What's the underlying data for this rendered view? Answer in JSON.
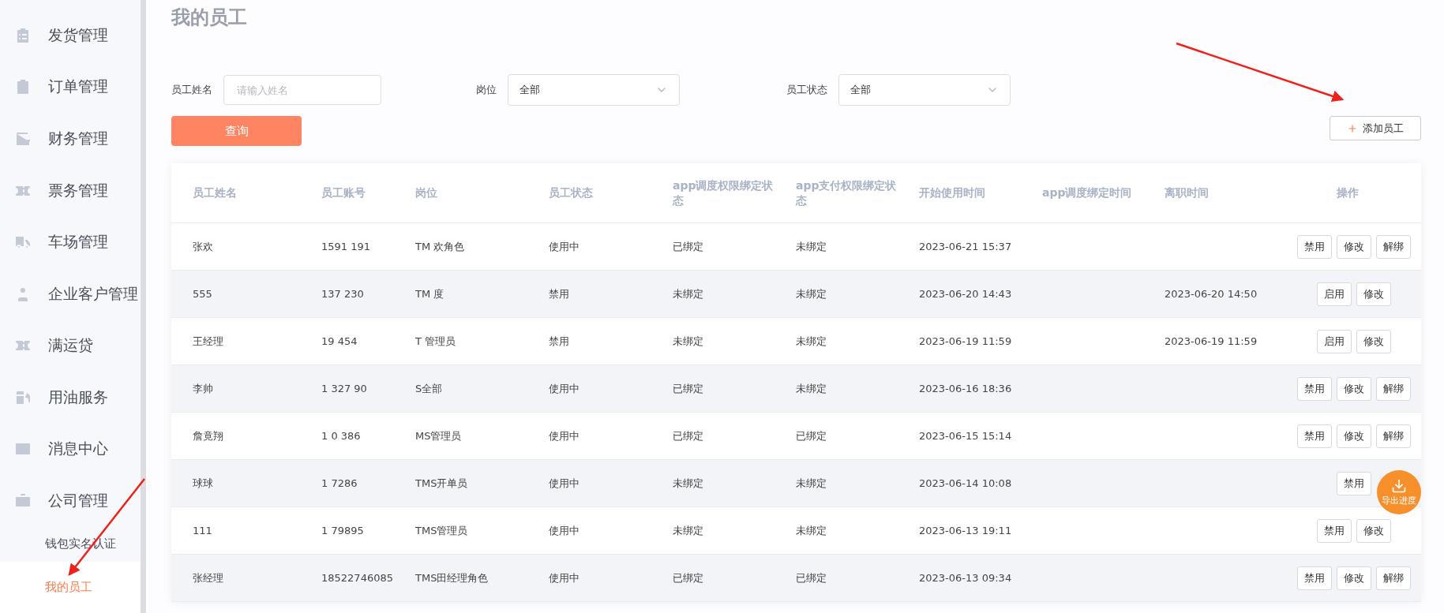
{
  "sidebar": {
    "items": [
      {
        "label": "发货管理",
        "selected": false
      },
      {
        "label": "订单管理",
        "selected": false
      },
      {
        "label": "财务管理",
        "selected": false
      },
      {
        "label": "票务管理",
        "selected": false
      },
      {
        "label": "车场管理",
        "selected": false
      },
      {
        "label": "企业客户管理",
        "selected": false
      },
      {
        "label": "满运贷",
        "selected": false
      },
      {
        "label": "用油服务",
        "selected": false
      },
      {
        "label": "消息中心",
        "selected": false
      },
      {
        "label": "公司管理",
        "selected": false,
        "expanded": true,
        "children": [
          {
            "label": "钱包实名认证",
            "selected": false
          },
          {
            "label": "我的员工",
            "selected": true
          }
        ]
      }
    ]
  },
  "page_title": "我的员工",
  "filters": [
    {
      "kind": "text",
      "label": "员工姓名",
      "placeholder": "请输入姓名"
    },
    {
      "kind": "select",
      "label": "岗位",
      "value": "全部"
    },
    {
      "kind": "select",
      "label": "员工状态",
      "value": "全部"
    }
  ],
  "query_button": "查询",
  "add_button": "添加员工",
  "table": {
    "columns": [
      "员工姓名",
      "员工账号",
      "岗位",
      "员工状态",
      "app调度权限绑定状态",
      "app支付权限绑定状态",
      "开始使用时间",
      "app调度绑定时间",
      "离职时间",
      "操作"
    ],
    "rows": [
      {
        "cells": [
          "张欢",
          "1591 191",
          "TM 欢角色",
          "使用中",
          "已绑定",
          "未绑定",
          "2023-06-21 15:37",
          "",
          ""
        ],
        "actions": [
          "禁用",
          "修改",
          "解绑"
        ]
      },
      {
        "cells": [
          "555",
          "137 230",
          "TM 度",
          "禁用",
          "未绑定",
          "未绑定",
          "2023-06-20 14:43",
          "",
          "2023-06-20 14:50"
        ],
        "actions": [
          "启用",
          "修改"
        ]
      },
      {
        "cells": [
          "王经理",
          "19 454",
          "T 管理员",
          "禁用",
          "未绑定",
          "未绑定",
          "2023-06-19 11:59",
          "",
          "2023-06-19 11:59"
        ],
        "actions": [
          "启用",
          "修改"
        ]
      },
      {
        "cells": [
          "李帅",
          "1 327 90",
          "S全部",
          "使用中",
          "已绑定",
          "未绑定",
          "2023-06-16 18:36",
          "",
          ""
        ],
        "actions": [
          "禁用",
          "修改",
          "解绑"
        ]
      },
      {
        "cells": [
          "詹竟翔",
          "1 0 386",
          "MS管理员",
          "使用中",
          "已绑定",
          "已绑定",
          "2023-06-15 15:14",
          "",
          ""
        ],
        "actions": [
          "禁用",
          "修改",
          "解绑"
        ]
      },
      {
        "cells": [
          "球球",
          "1 7286",
          "TMS开单员",
          "使用中",
          "未绑定",
          "未绑定",
          "2023-06-14 10:08",
          "",
          ""
        ],
        "actions": [
          "禁用"
        ]
      },
      {
        "cells": [
          "111",
          "1 79895",
          "TMS管理员",
          "使用中",
          "未绑定",
          "未绑定",
          "2023-06-13 19:11",
          "",
          ""
        ],
        "actions": [
          "禁用",
          "修改"
        ]
      },
      {
        "cells": [
          "张经理",
          "18522746085",
          "TMS田经理角色",
          "使用中",
          "已绑定",
          "已绑定",
          "2023-06-13 09:34",
          "",
          ""
        ],
        "actions": [
          "禁用",
          "修改",
          "解绑"
        ]
      }
    ]
  },
  "export_button": "导出进度"
}
